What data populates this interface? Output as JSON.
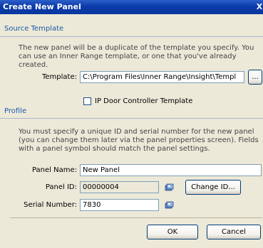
{
  "window": {
    "title": "Create New Panel",
    "close_glyph": "X"
  },
  "source_template": {
    "header": "Source Template",
    "description_line1": "The new panel will be a duplicate of the template you specify. You",
    "description_line2": "can use an Inner Range template, or one that you've already created.",
    "template_label": "Template:",
    "template_value": "C:\\Program Files\\Inner Range\\Insight\\Templ",
    "browse_label": "...",
    "ip_door_label": "IP Door Controller Template"
  },
  "profile": {
    "header": "Profile",
    "description_line1": "You must specify a unique ID and serial number for the new panel",
    "description_line2": "(you can change them later via the panel properties screen). Fields",
    "description_line3": "with a panel symbol should match the panel settings.",
    "panel_name_label": "Panel Name:",
    "panel_name_value": "New Panel",
    "panel_id_label": "Panel ID:",
    "panel_id_value": "00000004",
    "change_id_label": "Change ID...",
    "serial_label": "Serial Number:",
    "serial_value": "7830"
  },
  "actions": {
    "ok_label": "OK",
    "cancel_label": "Cancel"
  },
  "colors": {
    "titlebar": "#0a3aa8",
    "section_header_text": "#1a5aa6",
    "dialog_bg": "#ece9d8"
  },
  "icons": {
    "panel_symbol": "panel-symbol-icon"
  }
}
